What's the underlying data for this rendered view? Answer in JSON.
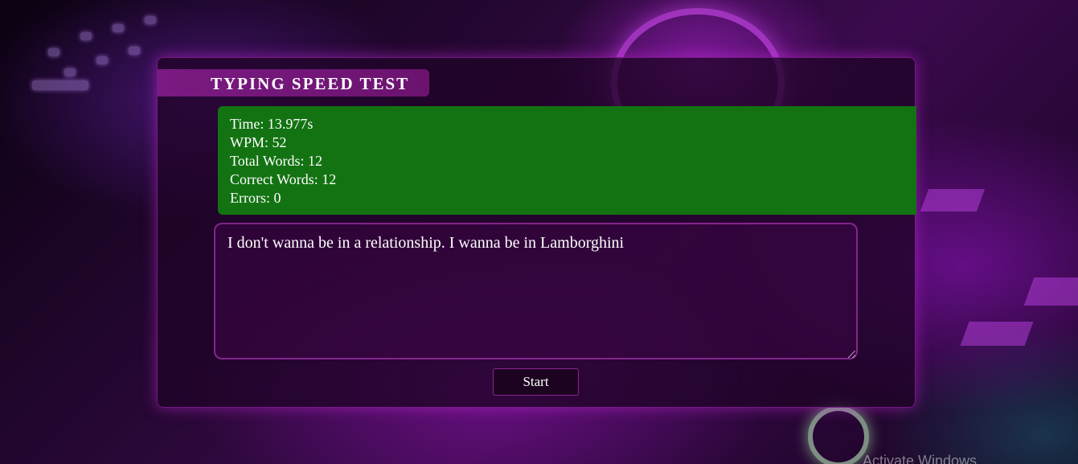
{
  "header": {
    "title": "TYPING SPEED TEST"
  },
  "results": {
    "time": "Time: 13.977s",
    "wpm": "WPM: 52",
    "total_words": "Total Words: 12",
    "correct_words": "Correct Words: 12",
    "errors": "Errors: 0"
  },
  "typing_area": {
    "value": "I don't wanna be in a relationship. I wanna be in Lamborghini"
  },
  "start_button": {
    "label": "Start"
  },
  "watermark": {
    "text": "Activate Windows"
  },
  "colors": {
    "results_background": "#137312",
    "title_banner": "#7a1a82",
    "panel_glow": "#c828dc"
  },
  "icons": [
    "resize-grip-icon"
  ]
}
